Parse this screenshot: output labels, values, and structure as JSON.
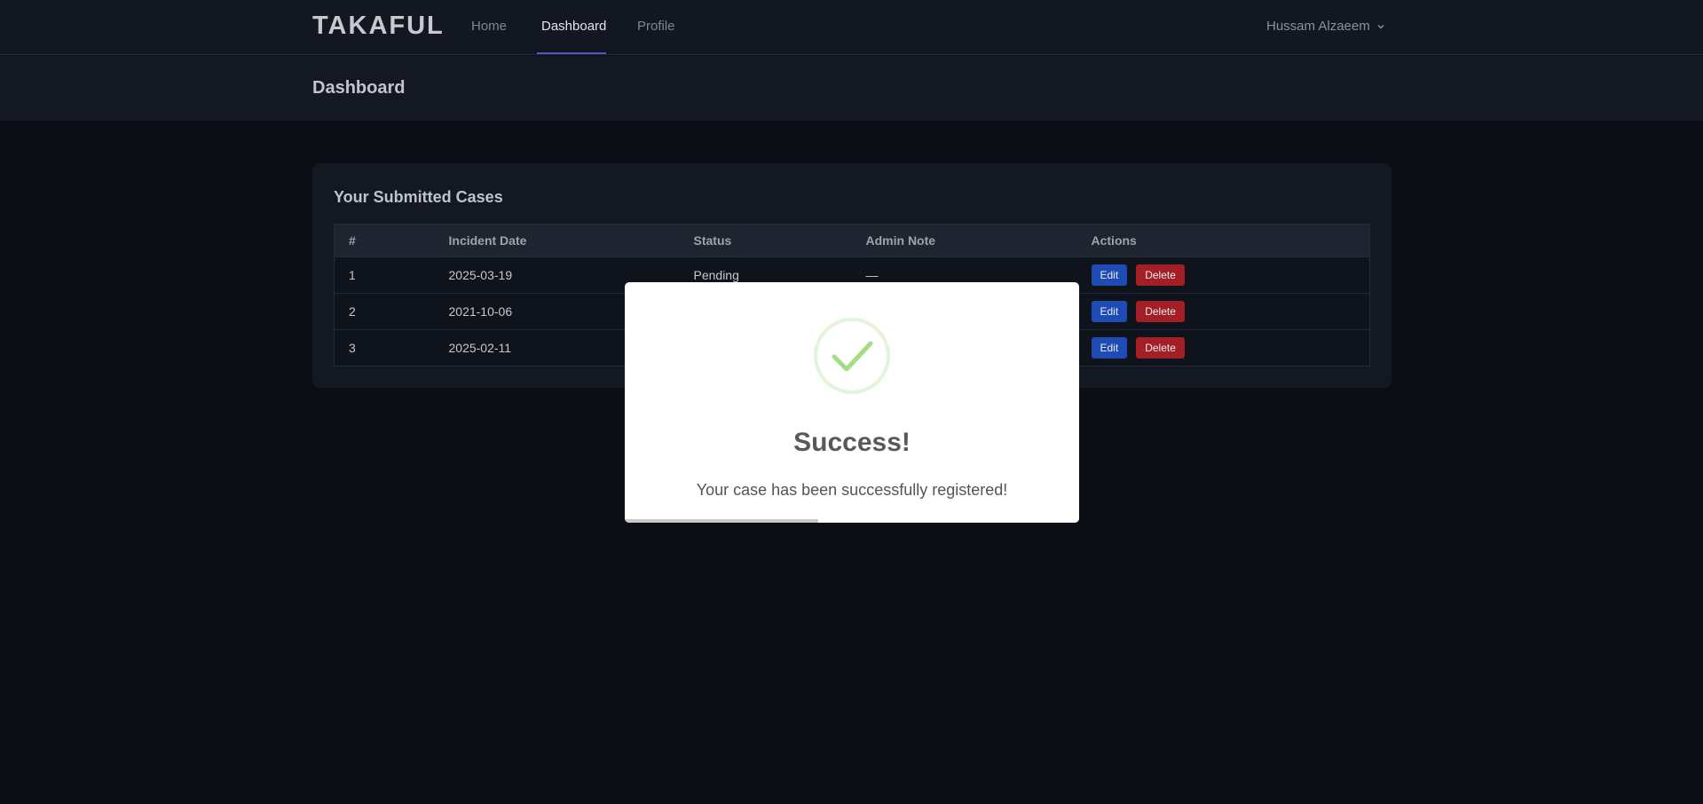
{
  "nav": {
    "brand": "TAKAFUL",
    "links": [
      {
        "label": "Home"
      },
      {
        "label": "Dashboard",
        "active": true
      },
      {
        "label": "Profile"
      }
    ],
    "user_name": "Hussam Alzaeem"
  },
  "header": {
    "title": "Dashboard"
  },
  "cases": {
    "title": "Your Submitted Cases",
    "columns": [
      "#",
      "Incident Date",
      "Status",
      "Admin Note",
      "Actions"
    ],
    "rows": [
      {
        "num": "1",
        "date": "2025-03-19",
        "status": "Pending",
        "note": "—"
      },
      {
        "num": "2",
        "date": "2021-10-06",
        "status": "",
        "note": ""
      },
      {
        "num": "3",
        "date": "2025-02-11",
        "status": "",
        "note": ""
      }
    ],
    "edit_label": "Edit",
    "delete_label": "Delete"
  },
  "modal": {
    "title": "Success!",
    "message": "Your case has been successfully registered!",
    "icon": "check-circle-icon",
    "timer_progress": 0.425
  },
  "colors": {
    "accent": "#5b4ec9",
    "edit": "#1f4bb5",
    "delete": "#a31f25",
    "success": "#a5dc86"
  }
}
